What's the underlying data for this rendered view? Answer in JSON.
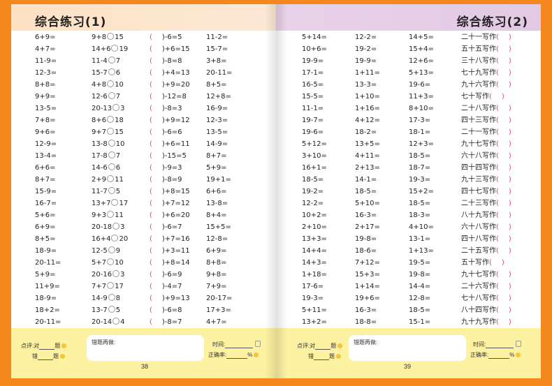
{
  "left_page": {
    "title": "综合练习(1)",
    "page_number": "38",
    "col1": [
      "6+9=",
      "4+7=",
      "11-9=",
      "12-3=",
      "8+8=",
      "9+9=",
      "13-5=",
      "7+8=",
      "9+6=",
      "12-9=",
      "13-4=",
      "6+6=",
      "8+7=",
      "15-9=",
      "16-7=",
      "5+6=",
      "6+9=",
      "8+5=",
      "18-9=",
      "20-11=",
      "5+9=",
      "11+9=",
      "18-9=",
      "18+2=",
      "20-11="
    ],
    "col2": [
      [
        "9+8",
        "15"
      ],
      [
        "14+6",
        "19"
      ],
      [
        "11-4",
        "7"
      ],
      [
        "15-7",
        "6"
      ],
      [
        "4+8",
        "10"
      ],
      [
        "12-6",
        "7"
      ],
      [
        "20-13",
        "3"
      ],
      [
        "8+6",
        "18"
      ],
      [
        "9+7",
        "15"
      ],
      [
        "13-8",
        "10"
      ],
      [
        "17-8",
        "7"
      ],
      [
        "14-6",
        "6"
      ],
      [
        "2+9",
        "11"
      ],
      [
        "11-7",
        "5"
      ],
      [
        "13+7",
        "17"
      ],
      [
        "9+3",
        "11"
      ],
      [
        "20-18",
        "3"
      ],
      [
        "16+4",
        "20"
      ],
      [
        "12-5",
        "9"
      ],
      [
        "5+7",
        "10"
      ],
      [
        "20-16",
        "3"
      ],
      [
        "7+7",
        "17"
      ],
      [
        "14-9",
        "8"
      ],
      [
        "13-7",
        "5"
      ],
      [
        "20-14",
        "4"
      ]
    ],
    "col3": [
      ")-6=5",
      ")+6=15",
      ")-8=8",
      ")+4=13",
      ")+9=20",
      ")-12=8",
      ")-8=3",
      ")+9=12",
      ")-6=6",
      ")+6=11",
      ")-15=5",
      ")-9=3",
      ")-8=9",
      ")+8=15",
      ")+7=12",
      ")+6=20",
      ")-6=7",
      ")+7=16",
      ")+3=11",
      ")+8=14",
      ")-6=9",
      ")-4=7",
      ")+9=13",
      ")-6=8",
      ")-8=7"
    ],
    "col4": [
      "11-2=",
      "15-7=",
      "3+8=",
      "20-11=",
      "8+5=",
      "12+8=",
      "16-9=",
      "12-3=",
      "13-5=",
      "14-9=",
      "8+7=",
      "5+9=",
      "19+1=",
      "6+6=",
      "13-8=",
      "8+4=",
      "15+5=",
      "12-8=",
      "6+9=",
      "8+8=",
      "9+8=",
      "7+9=",
      "20-17=",
      "17+3=",
      "4+7="
    ]
  },
  "right_page": {
    "title": "综合练习(2)",
    "page_number": "39",
    "col1": [
      "5+14=",
      "10+6=",
      "19-9=",
      "17-1=",
      "16-5=",
      "15-5=",
      "11-1=",
      "19-7=",
      "19-6=",
      "5+12=",
      "3+10=",
      "16+1=",
      "18-5=",
      "19-2=",
      "12-2=",
      "10+2=",
      "2+10=",
      "13+3=",
      "14+4=",
      "14+3=",
      "1+18=",
      "17-6=",
      "19-3=",
      "5+11=",
      "13+2="
    ],
    "col2": [
      "12-2=",
      "19-2=",
      "19-9=",
      "1+11=",
      "13-3=",
      "1+10=",
      "1+16=",
      "4+12=",
      "18-2=",
      "13+5=",
      "4+11=",
      "2+13=",
      "14-1=",
      "18-5=",
      "5+10=",
      "16-3=",
      "2+17=",
      "19-8=",
      "18-6=",
      "7+12=",
      "15+3=",
      "1+14=",
      "19+6=",
      "16-3=",
      "18-8="
    ],
    "col3": [
      "14+5=",
      "15+4=",
      "12+6=",
      "5+13=",
      "19-6=",
      "11+3=",
      "8+10=",
      "17-3=",
      "18-1=",
      "12+3=",
      "18-5=",
      "18-7=",
      "19-3=",
      "15+2=",
      "18-5=",
      "18-3=",
      "4+10=",
      "13-1=",
      "1+13=",
      "19-5=",
      "19-8=",
      "14-4=",
      "12-8=",
      "18-5=",
      "15-1="
    ],
    "col4": [
      "二十一写作",
      "五十五写作",
      "三十八写作",
      "七十九写作",
      "九十六写作",
      "七十写作",
      "二十八写作",
      "四十三写作",
      "二十一写作",
      "九十七写作",
      "六十八写作",
      "四十四写作",
      "九十三写作",
      "四十七写作",
      "二十三写作",
      "八十九写作",
      "六十八写作",
      "四十八写作",
      "二十五写作",
      "五十写作",
      "九十七写作",
      "二十六写作",
      "七十八写作",
      "八十四写作",
      "九十九写作"
    ]
  },
  "footer": {
    "comment_label": "点评:对",
    "ti": "题",
    "cuo": "错",
    "redo_label": "错题再做:",
    "time_label": "时间:",
    "accuracy_label": "正确率:",
    "percent": "%"
  },
  "colors": {
    "border": "#f5871f",
    "left_header": "#fde2c4",
    "right_header": "#e2c9e4",
    "footer": "#fdf1a2",
    "paren": "#e23c8c"
  }
}
